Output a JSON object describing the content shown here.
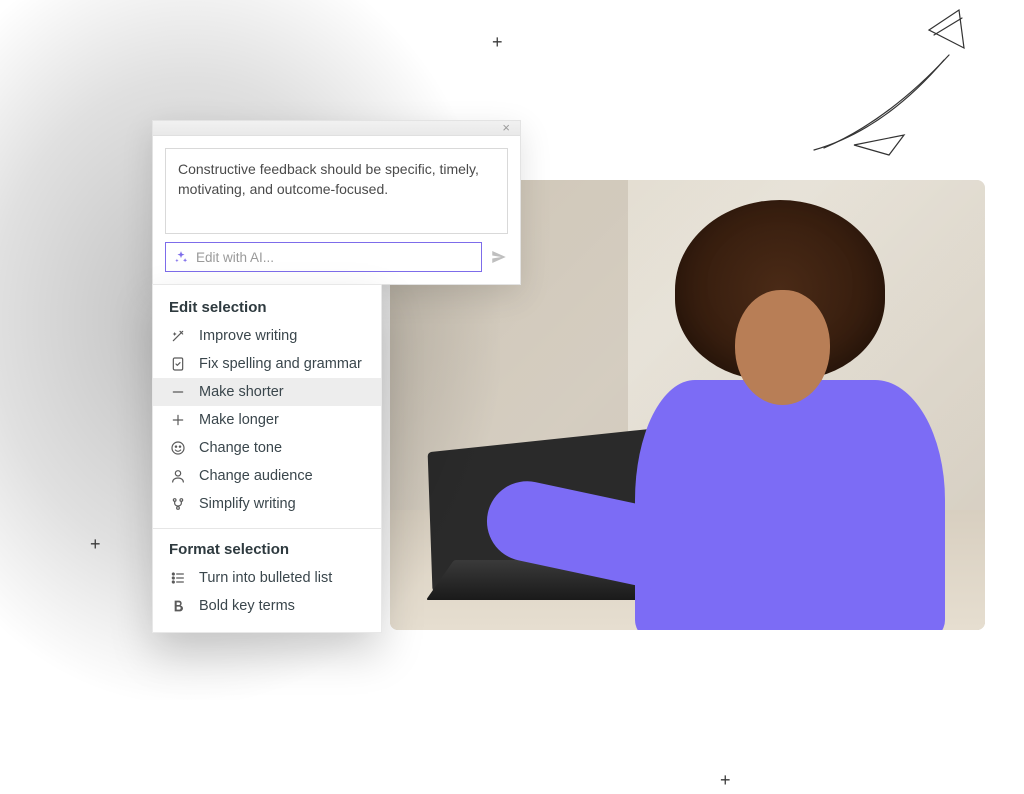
{
  "compose": {
    "text": "Constructive feedback should be specific, timely, motivating, and outcome-focused.",
    "ai_placeholder": "Edit with AI..."
  },
  "menu": {
    "edit_title": "Edit selection",
    "edit_items": [
      {
        "icon": "magic-wand-icon",
        "label": "Improve writing"
      },
      {
        "icon": "spellcheck-icon",
        "label": "Fix spelling and grammar"
      },
      {
        "icon": "minus-icon",
        "label": "Make shorter",
        "hover": true
      },
      {
        "icon": "plus-icon",
        "label": "Make longer"
      },
      {
        "icon": "smile-icon",
        "label": "Change tone"
      },
      {
        "icon": "person-icon",
        "label": "Change audience"
      },
      {
        "icon": "simplify-icon",
        "label": "Simplify writing"
      }
    ],
    "format_title": "Format selection",
    "format_items": [
      {
        "icon": "bulleted-list-icon",
        "label": "Turn into bulleted list"
      },
      {
        "icon": "bold-icon",
        "label": "Bold key terms"
      }
    ]
  }
}
